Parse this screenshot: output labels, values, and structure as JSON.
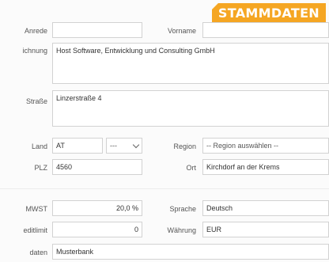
{
  "badge": "STAMMDATEN",
  "labels": {
    "anrede": "Anrede",
    "vorname": "Vorname",
    "bezeichnung": "ichnung",
    "strasse": "Straße",
    "land": "Land",
    "region": "Region",
    "plz": "PLZ",
    "ort": "Ort",
    "mwst": "MWST",
    "kreditlimit": "editlimit",
    "sprache": "Sprache",
    "waehrung": "Währung",
    "bankdaten": "daten"
  },
  "fields": {
    "anrede": "",
    "vorname": "",
    "bezeichnung": "Host Software, Entwicklung und Consulting GmbH",
    "strasse": "Linzerstraße 4",
    "land": "AT",
    "land_code": "---",
    "region": "-- Region auswählen --",
    "plz": "4560",
    "ort": "Kirchdorf an der Krems",
    "mwst": "20,0 %",
    "kreditlimit": "0",
    "sprache": "Deutsch",
    "waehrung": "EUR",
    "bankdaten": "Musterbank"
  }
}
